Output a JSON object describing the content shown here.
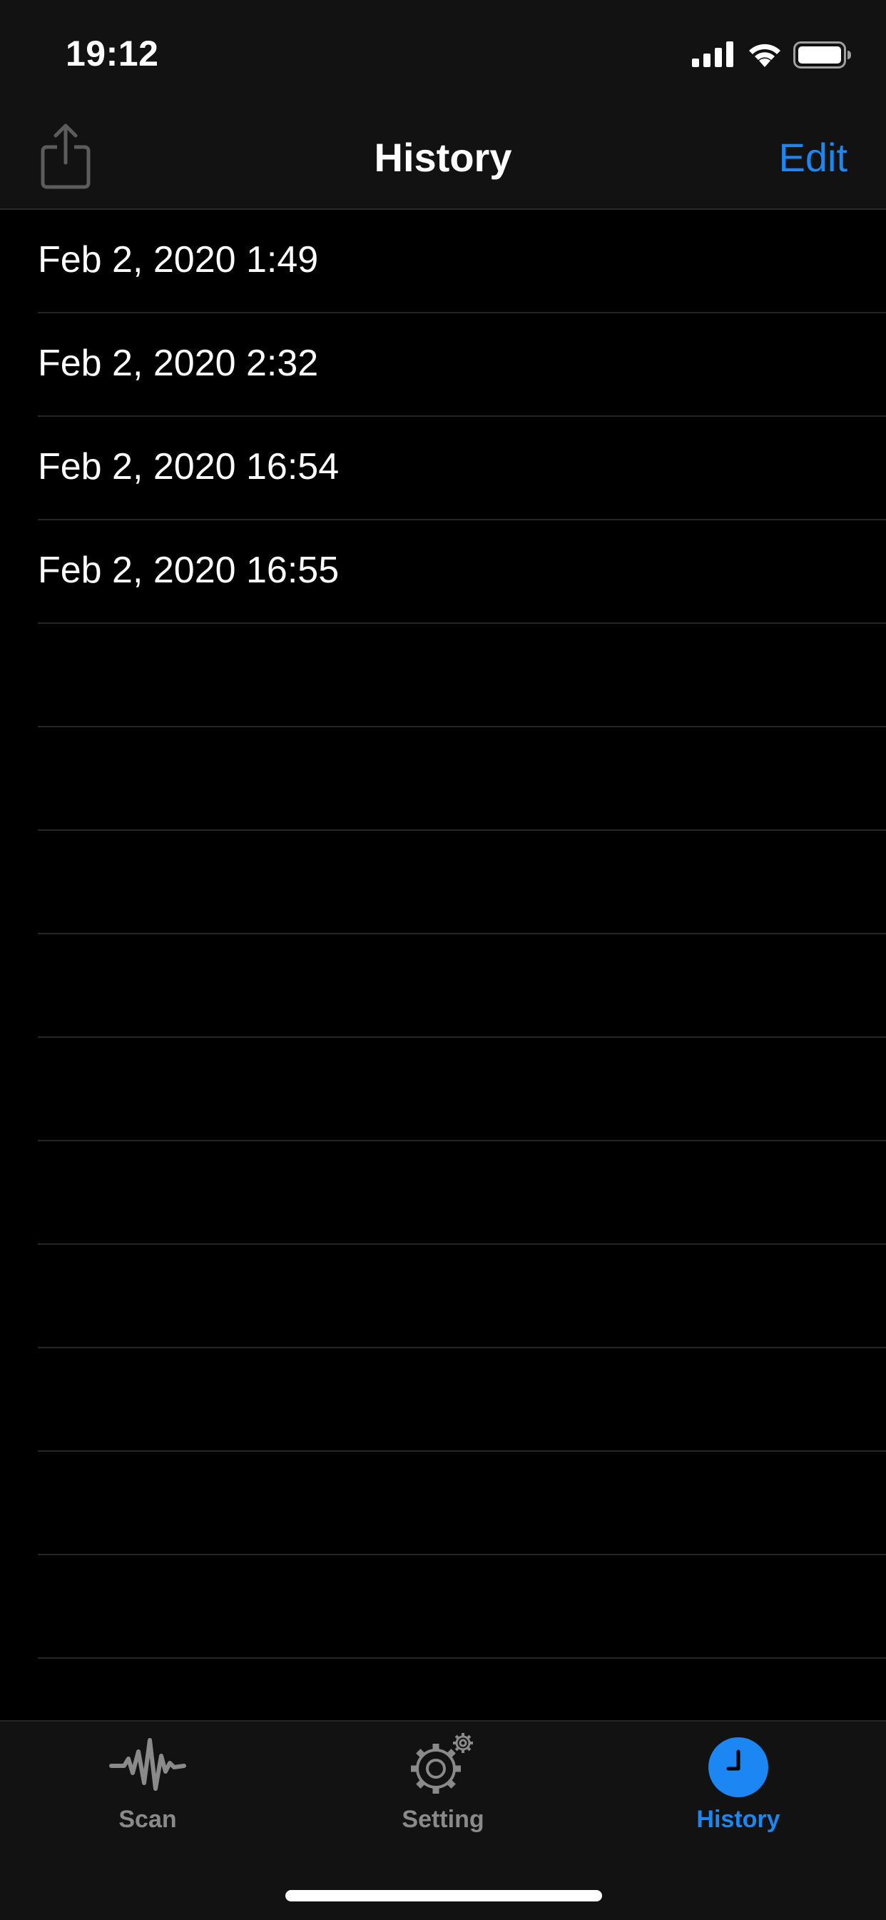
{
  "status_bar": {
    "time": "19:12"
  },
  "nav": {
    "title": "History",
    "edit_label": "Edit",
    "share_icon": "share-icon"
  },
  "history": {
    "items": [
      {
        "label": "Feb 2, 2020 1:49"
      },
      {
        "label": "Feb 2, 2020 2:32"
      },
      {
        "label": "Feb 2, 2020 16:54"
      },
      {
        "label": "Feb 2, 2020 16:55"
      },
      {
        "label": ""
      },
      {
        "label": ""
      },
      {
        "label": ""
      },
      {
        "label": ""
      },
      {
        "label": ""
      },
      {
        "label": ""
      },
      {
        "label": ""
      },
      {
        "label": ""
      },
      {
        "label": ""
      },
      {
        "label": ""
      }
    ]
  },
  "tabs": [
    {
      "label": "Scan",
      "icon": "waveform-icon",
      "active": false
    },
    {
      "label": "Setting",
      "icon": "gear-icon",
      "active": false
    },
    {
      "label": "History",
      "icon": "clock-icon",
      "active": true
    }
  ],
  "colors": {
    "accent": "#1c87f2",
    "background": "#000000",
    "bar_background": "#121212",
    "inactive_tab": "#8a8a8a"
  }
}
